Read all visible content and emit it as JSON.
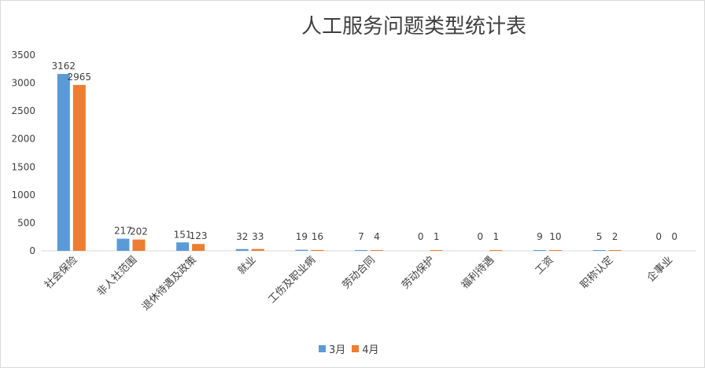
{
  "chart_data": {
    "type": "bar",
    "title": "人工服务问题类型统计表",
    "categories": [
      "社会保险",
      "非人社范围",
      "退休待遇及政策",
      "就业",
      "工伤及职业病",
      "劳动合同",
      "劳动保护",
      "福利待遇",
      "工资",
      "职称认定",
      "企事业"
    ],
    "series": [
      {
        "name": "3月",
        "color": "#5b9bd5",
        "values": [
          3162,
          217,
          151,
          32,
          19,
          7,
          0,
          0,
          9,
          5,
          0
        ]
      },
      {
        "name": "4月",
        "color": "#ed7d31",
        "values": [
          2965,
          202,
          123,
          33,
          16,
          4,
          1,
          1,
          10,
          2,
          0
        ]
      }
    ],
    "ylim": [
      0,
      3500
    ],
    "yticks": [
      0,
      500,
      1000,
      1500,
      2000,
      2500,
      3000,
      3500
    ],
    "xlabel": "",
    "ylabel": "",
    "grid": false,
    "legend_position": "bottom"
  }
}
